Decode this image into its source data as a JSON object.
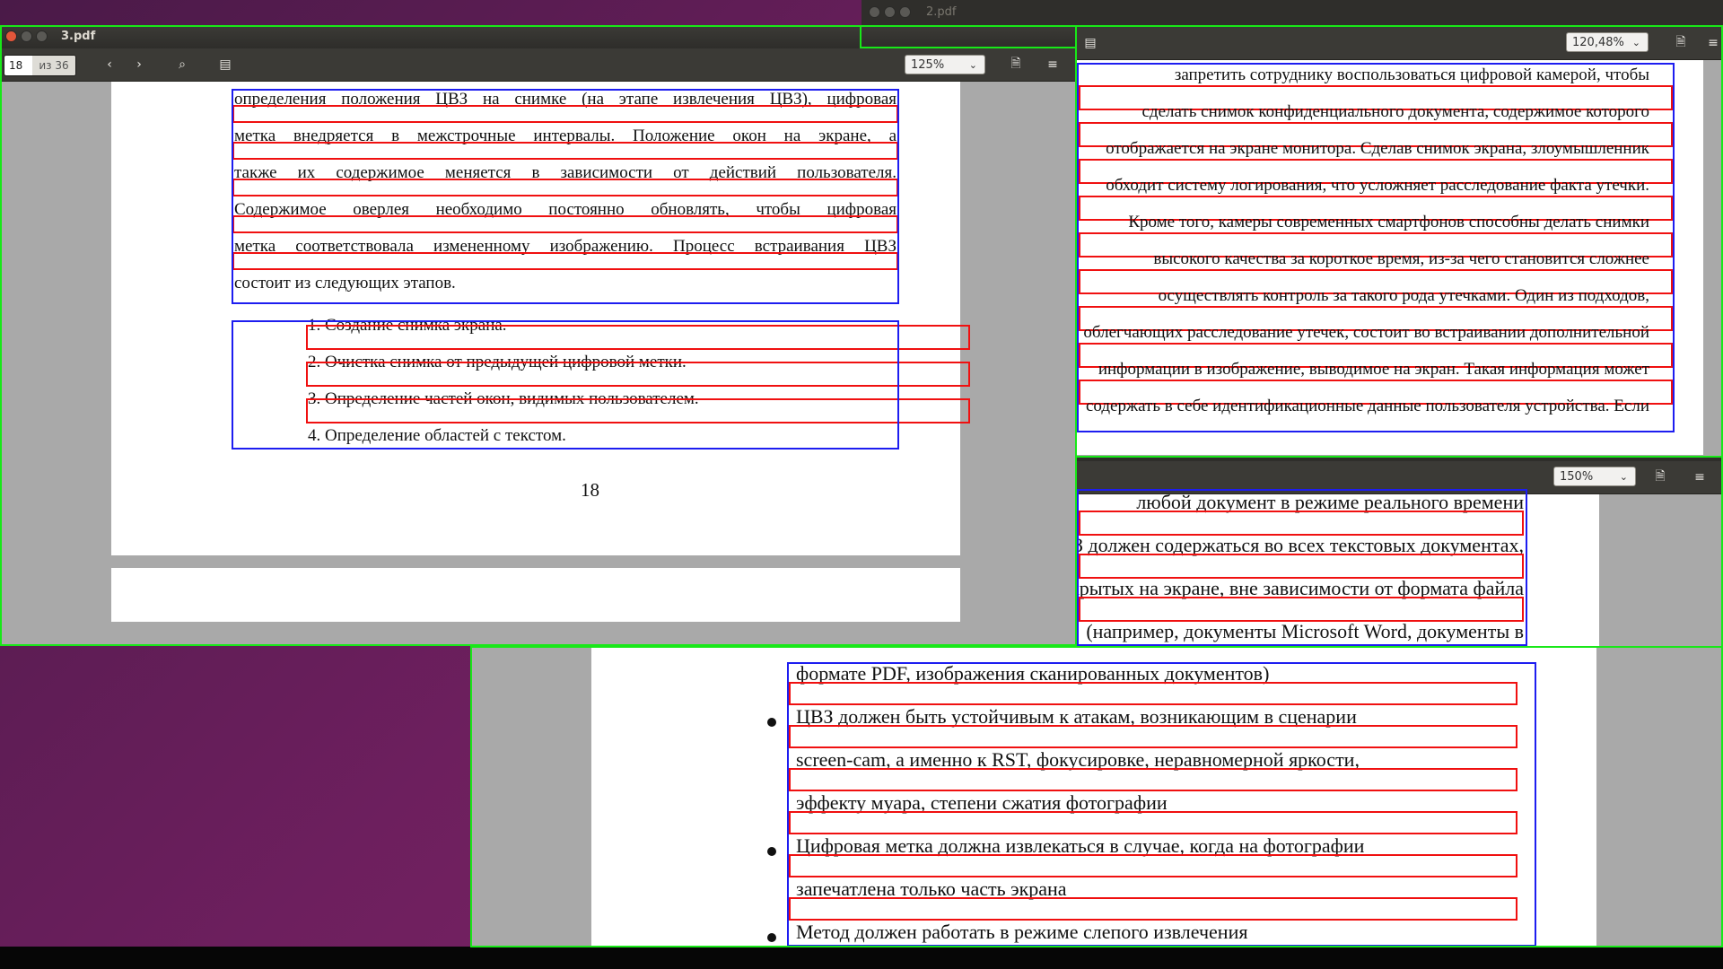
{
  "desktop_top_title": "2.pdf",
  "win_left": {
    "title": "3.pdf",
    "page_current": "18",
    "page_total": "из 36",
    "zoom": "125%",
    "paragraph": [
      "определения положения ЦВЗ на снимке (на этапе извлечения ЦВЗ), цифровая",
      "метка внедряется в межстрочные интервалы. Положение окон на экране, а",
      "также их содержимое меняется в зависимости от действий пользователя.",
      "Содержимое оверлея необходимо постоянно обновлять, чтобы цифровая",
      "метка соответствовала измененному изображению. Процесс встраивания ЦВЗ",
      "состоит из следующих этапов."
    ],
    "list": [
      "1.  Создание снимка экрана.",
      "2.  Очистка снимка от предыдущей цифровой метки.",
      "3.  Определение частей окон, видимых пользователем.",
      "4.  Определение областей с текстом."
    ],
    "page_number": "18"
  },
  "win_right_top": {
    "zoom": "120,48%",
    "lines": [
      "запретить сотруднику воспользоваться цифровой камерой, чтобы",
      "сделать снимок конфиденциального документа, содержимое которого",
      "отображается на экране монитора. Сделав снимок экрана, злоумышленник",
      "обходит систему логирования, что усложняет расследование факта утечки.",
      "Кроме того, камеры современных смартфонов способны делать снимки",
      "высокого качества за короткое время, из-за чего становится сложнее",
      "осуществлять контроль за такого рода утечками. Один из подходов,",
      "облегчающих расследование утечек, состоит во встраивании дополнительной",
      "информации в изображение, выводимое на экран. Такая информация может",
      "содержать в себе идентификационные данные пользователя устройства. Если"
    ]
  },
  "win_right_bottom": {
    "zoom": "150%",
    "lines": [
      "любой документ в режиме реального времени",
      "ЦВЗ должен содержаться во всех текстовых документах,",
      "открытых на экране, вне зависимости от формата файла",
      "(например, документы Microsoft Word, документы в"
    ],
    "lower_lines": [
      "формате PDF, изображения сканированных документов)",
      "ЦВЗ должен быть устойчивым к атакам, возникающим в сценарии",
      "screen-cam, а именно к RST, фокусировке, неравномерной яркости,",
      "эффекту муара, степени сжатия фотографии",
      "Цифровая метка должна извлекаться в случае, когда на фотографии",
      "запечатлена только часть экрана",
      "Метод должен работать в режиме слепого извлечения"
    ]
  },
  "colors": {
    "desktop": "#6d1f5e",
    "titlebar": "#3c3b37",
    "toolbar": "#3b3a36",
    "bbox_window": "#18e818",
    "bbox_block": "#1d1df0",
    "bbox_line": "#f01010"
  },
  "icons": [
    "close-icon",
    "minimize-icon",
    "maximize-icon",
    "prev-page-icon",
    "next-page-icon",
    "search-icon",
    "sidebar-icon",
    "bookmark-icon",
    "menu-icon",
    "dropdown-chevron-icon"
  ]
}
